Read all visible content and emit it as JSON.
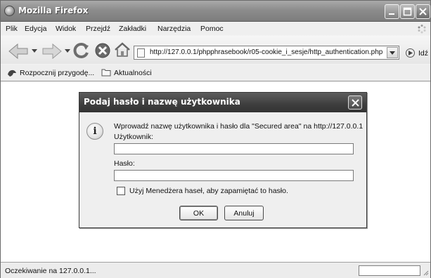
{
  "window": {
    "title": "Mozilla Firefox"
  },
  "menubar": {
    "items": [
      "Plik",
      "Edycja",
      "Widok",
      "Przejdź",
      "Zakładki",
      "Narzędzia",
      "Pomoc"
    ]
  },
  "navbar": {
    "url": "http://127.0.0.1/phpphrasebook/r05-cookie_i_sesje/http_authentication.php",
    "go_label": "Idź"
  },
  "bookmarks": {
    "items": [
      "Rozpocznij przygodę...",
      "Aktualności"
    ]
  },
  "status": {
    "text": "Oczekiwanie na 127.0.0.1..."
  },
  "dialog": {
    "title": "Podaj hasło i nazwę użytkownika",
    "message": "Wprowadź nazwę użytkownika i hasło dla \"Secured area\" na http://127.0.0.1",
    "username_label": "Użytkownik:",
    "username_value": "",
    "password_label": "Hasło:",
    "password_value": "",
    "remember_label": "Użyj Menedżera haseł, aby zapamiętać to hasło.",
    "remember_checked": false,
    "ok_label": "OK",
    "cancel_label": "Anuluj"
  }
}
